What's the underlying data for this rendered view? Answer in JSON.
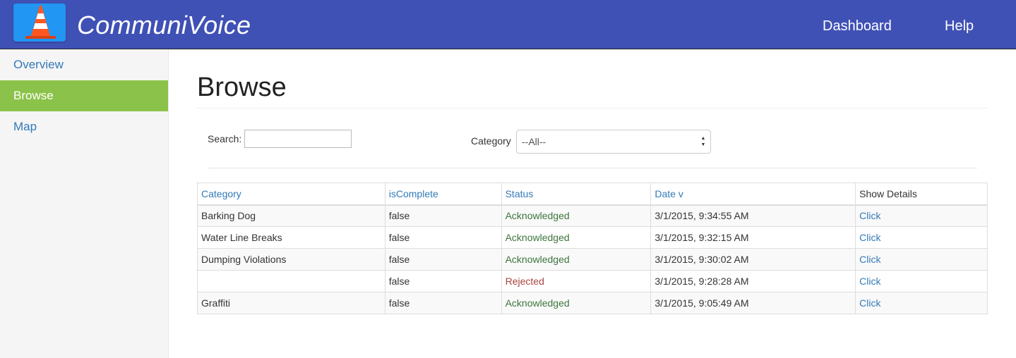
{
  "header": {
    "brand": "CommuniVoice",
    "logo_icon": "traffic-cone-icon",
    "nav": {
      "dashboard": "Dashboard",
      "help": "Help"
    },
    "colors": {
      "bar": "#3f51b5",
      "logo_bg": "#2196f3"
    }
  },
  "sidebar": {
    "items": [
      {
        "label": "Overview",
        "active": false
      },
      {
        "label": "Browse",
        "active": true
      },
      {
        "label": "Map",
        "active": false
      }
    ],
    "colors": {
      "active_bg": "#8bc34a",
      "link": "#337ab7"
    }
  },
  "main": {
    "title": "Browse",
    "search": {
      "label": "Search:",
      "value": "",
      "placeholder": ""
    },
    "category_filter": {
      "label": "Category",
      "selected": "--All--"
    }
  },
  "table": {
    "columns": [
      "Category",
      "isComplete",
      "Status",
      "Date v",
      "Show Details"
    ],
    "rows": [
      {
        "category": "Barking Dog",
        "isComplete": "false",
        "status": "Acknowledged",
        "date": "3/1/2015, 9:34:55 AM",
        "details": "Click"
      },
      {
        "category": "Water Line Breaks",
        "isComplete": "false",
        "status": "Acknowledged",
        "date": "3/1/2015, 9:32:15 AM",
        "details": "Click"
      },
      {
        "category": "Dumping Violations",
        "isComplete": "false",
        "status": "Acknowledged",
        "date": "3/1/2015, 9:30:02 AM",
        "details": "Click"
      },
      {
        "category": "",
        "isComplete": "false",
        "status": "Rejected",
        "date": "3/1/2015, 9:28:28 AM",
        "details": "Click"
      },
      {
        "category": "Graffiti",
        "isComplete": "false",
        "status": "Acknowledged",
        "date": "3/1/2015, 9:05:49 AM",
        "details": "Click"
      }
    ],
    "status_colors": {
      "Acknowledged": "#3c763d",
      "Rejected": "#a94442"
    }
  }
}
